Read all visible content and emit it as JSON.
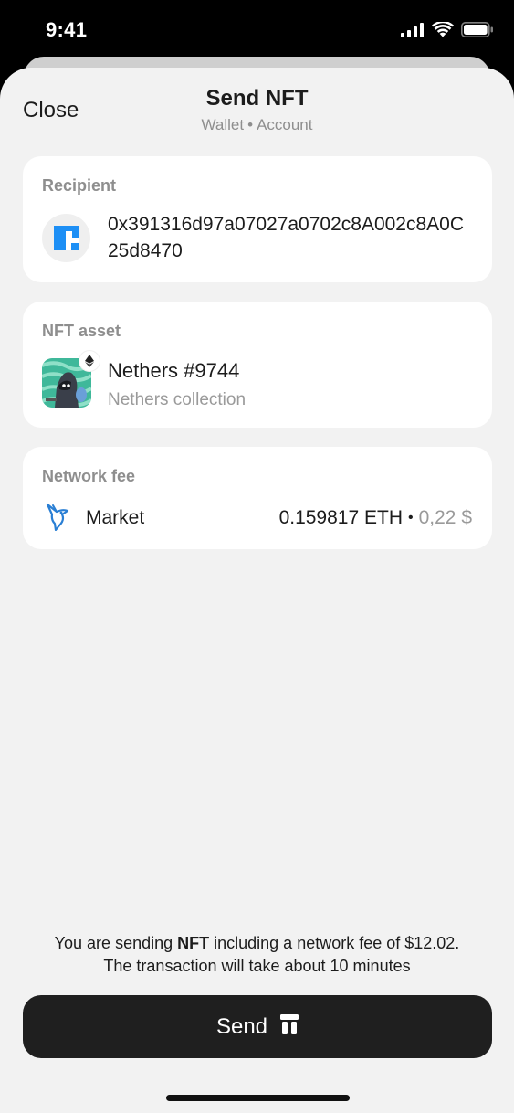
{
  "status_bar": {
    "time": "9:41",
    "icons": [
      "cellular-signal-icon",
      "wifi-icon",
      "battery-icon"
    ]
  },
  "header": {
    "close_label": "Close",
    "title": "Send NFT",
    "wallet": "Wallet",
    "account": "Account",
    "separator": "•"
  },
  "recipient": {
    "label": "Recipient",
    "address": "0x391316d97a07027a0702c8A002c8A0C25d8470",
    "avatar_icon": "identicon-avatar-icon"
  },
  "nft_asset": {
    "label": "NFT asset",
    "name": "Nethers #9744",
    "collection": "Nethers collection",
    "chain_badge_icon": "ethereum-icon"
  },
  "network_fee": {
    "label": "Network fee",
    "speed": "Market",
    "crypto_amount": "0.159817 ETH",
    "separator": "•",
    "fiat_amount": "0,22 $",
    "speed_icon": "hummingbird-icon"
  },
  "summary": {
    "line1_prefix": "You are sending ",
    "line1_bold": "NFT",
    "line1_suffix": " including a network fee of $12.02.",
    "line2": "The transaction will take about 10 minutes"
  },
  "send_button": {
    "label": "Send",
    "icon": "ledger-device-icon"
  },
  "colors": {
    "sheet_background": "#f2f2f2",
    "card_background": "#ffffff",
    "primary_text": "#1c1c1c",
    "secondary_text": "#8e8e8e",
    "button_background": "#1f1f1f",
    "avatar_blue": "#1d8ff5",
    "fee_icon_blue": "#2a7fd4"
  }
}
